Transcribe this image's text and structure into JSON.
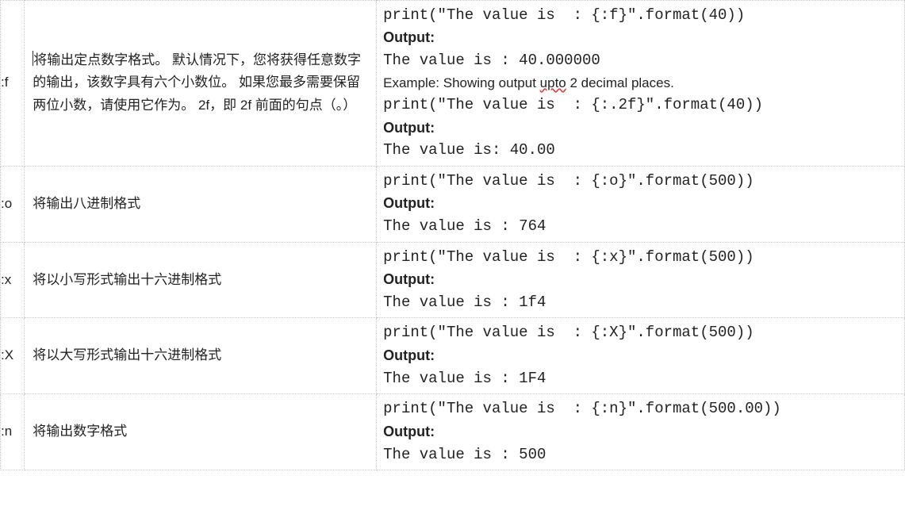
{
  "rows": [
    {
      "spec": ":f",
      "desc": "将输出定点数字格式。 默认情况下，您将获得任意数字的输出，该数字具有六个小数位。 如果您最多需要保留两位小数，请使用它作为。 2f，即 2f 前面的句点（。）",
      "ex_code1": "print(\"The value is  : {:f}\".format(40))",
      "ex_out_label": "Output:",
      "ex_out1": "The value is  : 40.000000",
      "ex_mid_prefix": "Example: Showing output ",
      "ex_mid_underlined": "upto",
      "ex_mid_suffix": " 2 decimal places.",
      "ex_code2": "print(\"The value is  : {:.2f}\".format(40))",
      "ex_out2": "The value is: 40.00"
    },
    {
      "spec": ":o",
      "desc": "将输出八进制格式",
      "ex_code1": "print(\"The value is  : {:o}\".format(500))",
      "ex_out_label": "Output:",
      "ex_out1": "The value is  : 764"
    },
    {
      "spec": ":x",
      "desc": "将以小写形式输出十六进制格式",
      "ex_code1": "print(\"The value is  : {:x}\".format(500))",
      "ex_out_label": "Output:",
      "ex_out1": "The value is  : 1f4"
    },
    {
      "spec": ":X",
      "desc": "将以大写形式输出十六进制格式",
      "ex_code1": "print(\"The value is  : {:X}\".format(500))",
      "ex_out_label": "Output:",
      "ex_out1": "The value is  : 1F4"
    },
    {
      "spec": ":n",
      "desc": "将输出数字格式",
      "ex_code1": "print(\"The value is  : {:n}\".format(500.00))",
      "ex_out_label": "Output:",
      "ex_out1": "The value is  : 500"
    }
  ]
}
